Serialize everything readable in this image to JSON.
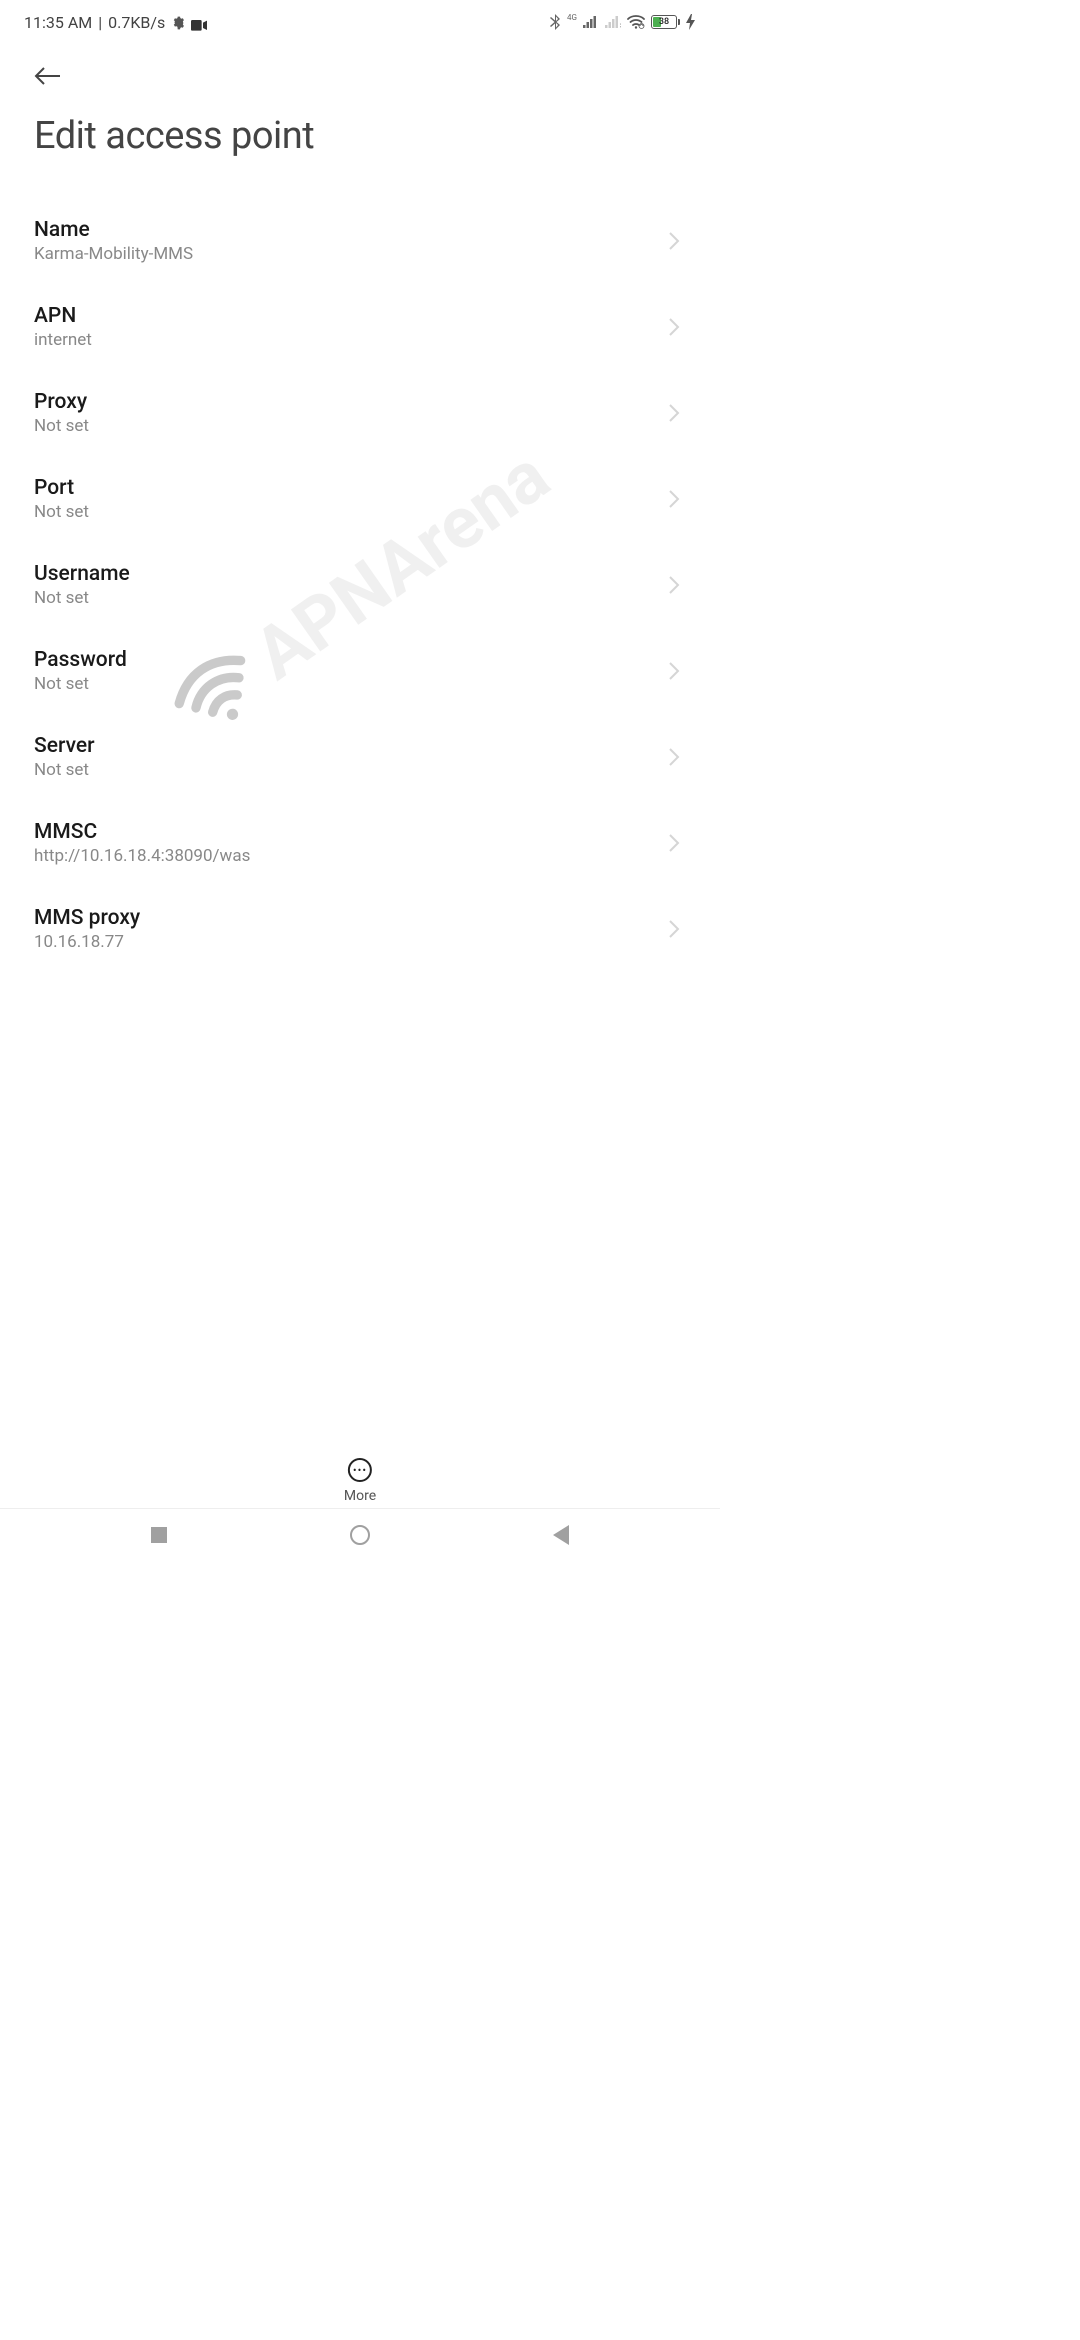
{
  "status_bar": {
    "time": "11:35 AM",
    "speed": "0.7KB/s",
    "network_type": "4G",
    "battery_percent": "38"
  },
  "header": {
    "title": "Edit access point"
  },
  "settings": {
    "name": {
      "label": "Name",
      "value": "Karma-Mobility-MMS"
    },
    "apn": {
      "label": "APN",
      "value": "internet"
    },
    "proxy": {
      "label": "Proxy",
      "value": "Not set"
    },
    "port": {
      "label": "Port",
      "value": "Not set"
    },
    "username": {
      "label": "Username",
      "value": "Not set"
    },
    "password": {
      "label": "Password",
      "value": "Not set"
    },
    "server": {
      "label": "Server",
      "value": "Not set"
    },
    "mmsc": {
      "label": "MMSC",
      "value": "http://10.16.18.4:38090/was"
    },
    "mms_proxy": {
      "label": "MMS proxy",
      "value": "10.16.18.77"
    }
  },
  "footer": {
    "more_label": "More"
  },
  "watermark": "APNArena"
}
